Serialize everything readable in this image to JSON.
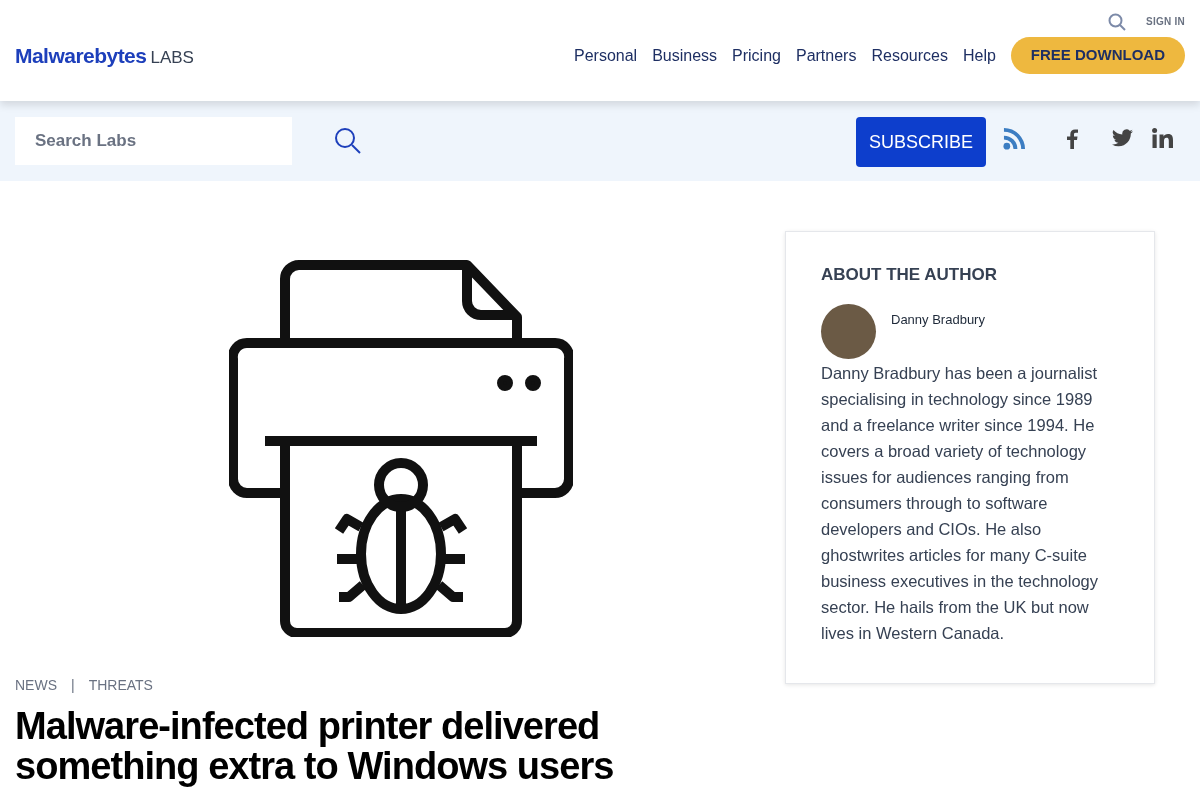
{
  "top_bar": {
    "sign_in": "SIGN IN"
  },
  "logo": {
    "brand": "Malwarebytes",
    "suffix": "LABS"
  },
  "nav": [
    "Personal",
    "Business",
    "Pricing",
    "Partners",
    "Resources",
    "Help"
  ],
  "download_button": "FREE DOWNLOAD",
  "search": {
    "placeholder": "Search Labs"
  },
  "subscribe_button": "SUBSCRIBE",
  "article": {
    "categories": [
      "NEWS",
      "THREATS"
    ],
    "separator": "|",
    "title": "Malware-infected printer delivered something extra to Windows users"
  },
  "author_card": {
    "heading": "ABOUT THE AUTHOR",
    "name": "Danny Bradbury",
    "bio": "Danny Bradbury has been a journalist specialising in technology since 1989 and a freelance writer since 1994. He covers a broad variety of technology issues for audiences ranging from consumers through to software developers and CIOs. He also ghostwrites articles for many C-suite business executives in the technology sector. He hails from the UK but now lives in Western Canada."
  }
}
